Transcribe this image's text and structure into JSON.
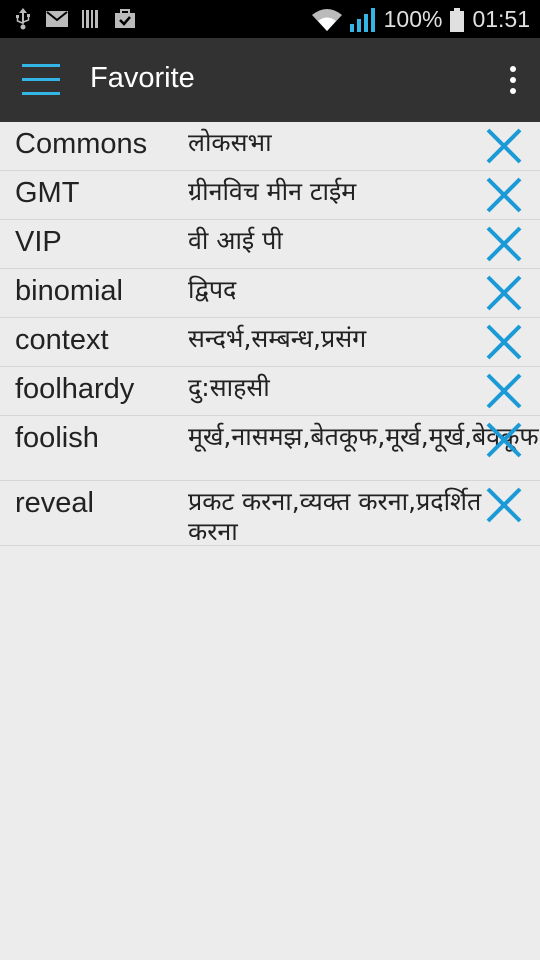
{
  "status_bar": {
    "battery": "100%",
    "time": "01:51"
  },
  "app_bar": {
    "title": "Favorite"
  },
  "favorites": [
    {
      "word": "Commons",
      "meaning": "लोकसभा"
    },
    {
      "word": "GMT",
      "meaning": "ग्रीनविच मीन टाईम"
    },
    {
      "word": "VIP",
      "meaning": "वी आई पी"
    },
    {
      "word": "binomial",
      "meaning": "द्विपद"
    },
    {
      "word": "context",
      "meaning": "सन्दर्भ,सम्बन्ध,प्रसंग"
    },
    {
      "word": "foolhardy",
      "meaning": "दु:साहसी"
    },
    {
      "word": "foolish",
      "meaning": "मूर्ख,नासमझ,बेतकूफ,मूर्ख,मूर्ख,बेवकूफ,मूर्खतापूर्ण"
    },
    {
      "word": "reveal",
      "meaning": "प्रकट करना,व्यक्त करना,प्रदर्शित करना"
    }
  ],
  "colors": {
    "accent": "#33b5e5",
    "app_bar": "#323232",
    "background": "#ececec"
  }
}
